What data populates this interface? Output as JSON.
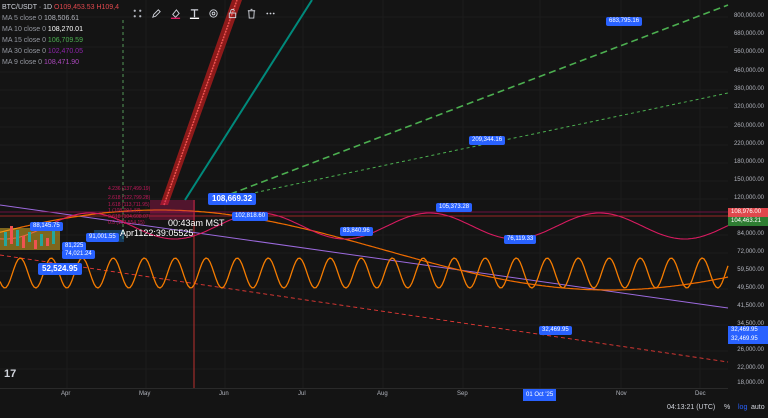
{
  "header": {
    "symbol": "BTC/USDT · 1D",
    "ohlc_o": "O109,453.53",
    "ohlc_h": "H109,4"
  },
  "indicators": [
    {
      "label": "MA 5 close 0",
      "value": "108,506.61",
      "color": "#b2b5be"
    },
    {
      "label": "MA 10 close 0",
      "value": "108,270.01",
      "color": "#ffffff"
    },
    {
      "label": "MA 15 close 0",
      "value": "106,709.59",
      "color": "#4caf50"
    },
    {
      "label": "MA 30 close 0",
      "value": "102,470.05",
      "color": "#8e24aa"
    },
    {
      "label": "MA 9 close 0",
      "value": "108,471.90",
      "color": "#ab47bc"
    }
  ],
  "toolbar": {
    "icons": [
      "drag-handle-icon",
      "pencil-icon",
      "fill-icon",
      "text-icon",
      "settings-icon",
      "lock-icon",
      "delete-icon",
      "more-icon"
    ]
  },
  "y_axis": {
    "ticks": [
      "800,000.00",
      "680,000.00",
      "560,000.00",
      "460,000.00",
      "380,000.00",
      "320,000.00",
      "260,000.00",
      "220,000.00",
      "180,000.00",
      "150,000.00",
      "120,000.00",
      "84,000.00",
      "72,000.00",
      "59,500.00",
      "49,500.00",
      "41,500.00",
      "34,500.00",
      "26,000.00",
      "22,000.00",
      "18,000.00"
    ],
    "badges": [
      {
        "value": "108,976.00",
        "color": "#e0484d"
      },
      {
        "value": "104,463.21",
        "color": "#2e7d32"
      },
      {
        "value": "32,469.95",
        "color": "#2962ff"
      },
      {
        "value": "32,469.95",
        "color": "#2962ff"
      }
    ]
  },
  "x_axis": {
    "ticks": [
      "Apr",
      "May",
      "Jun",
      "Jul",
      "Aug",
      "Sep",
      "Nov",
      "Dec"
    ],
    "highlight": "01 Oct '25"
  },
  "price_labels": {
    "current": "108,669.32",
    "target_high": "683,795.16",
    "mid_target": "209,344.16",
    "l1": "102,818.60",
    "l2": "83,840.96",
    "l3": "105,373.28",
    "l4": "76,119.33",
    "l5": "32,469.95",
    "left1": "88,145.75",
    "left2": "52,524.95",
    "left3": "81,225",
    "left4": "74,021.24",
    "left5": "91,001.55"
  },
  "annotations": {
    "time_overlay": "00:43am MST",
    "date_overlay": "Apr1122:39:05525",
    "fib_lines": [
      "4.236 (137,499.19)",
      "2.618 (122,799.28)",
      "1.618 (113,711.95)",
      "1 (108,094.47)",
      "0.618 (104,608.07)",
      "0.5 (103,554.15)"
    ]
  },
  "status": {
    "time": "04:13:21 (UTC)",
    "percent": "%",
    "log": "log",
    "auto": "auto"
  },
  "colors": {
    "background": "#141414",
    "accent": "#2962ff",
    "wave_orange": "#f57c00",
    "wave_pink": "#d81b60",
    "green_dashed": "#4caf50",
    "red_dashed": "#e53935",
    "purple": "#9c6ade"
  }
}
